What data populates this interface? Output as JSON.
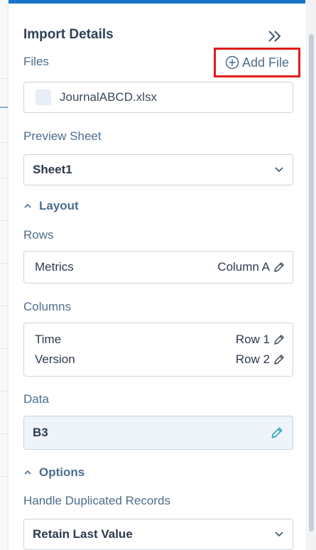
{
  "panel": {
    "title": "Import Details",
    "collapse_icon": "double-chevron-right-icon"
  },
  "files": {
    "label": "Files",
    "add_file_label": "Add File",
    "add_icon": "circle-plus-icon",
    "items": [
      {
        "name": "JournalABCD.xlsx"
      }
    ]
  },
  "preview_sheet": {
    "label": "Preview Sheet",
    "value": "Sheet1"
  },
  "layout": {
    "section_label": "Layout",
    "rows": {
      "label": "Rows",
      "items": [
        {
          "name": "Metrics",
          "source": "Column A"
        }
      ]
    },
    "columns": {
      "label": "Columns",
      "items": [
        {
          "name": "Time",
          "source": "Row 1"
        },
        {
          "name": "Version",
          "source": "Row 2"
        }
      ]
    },
    "data": {
      "label": "Data",
      "value": "B3"
    }
  },
  "options": {
    "section_label": "Options",
    "duplicates": {
      "label": "Handle Duplicated Records",
      "value": "Retain Last Value"
    }
  },
  "colors": {
    "accent": "#1a73c8",
    "highlight_border": "#e01b1b",
    "edit_active": "#2aa6b8",
    "label": "#4c6d8c"
  }
}
